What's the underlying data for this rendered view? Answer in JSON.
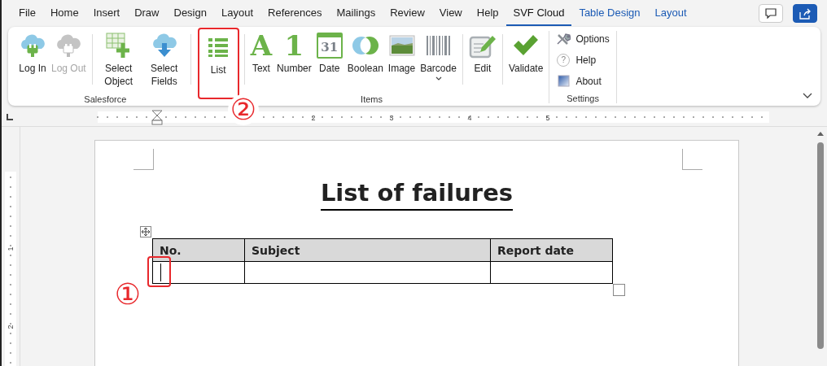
{
  "menu_tabs": [
    {
      "label": "File",
      "selected": false,
      "kind": "standard"
    },
    {
      "label": "Home",
      "selected": false,
      "kind": "standard"
    },
    {
      "label": "Insert",
      "selected": false,
      "kind": "standard"
    },
    {
      "label": "Draw",
      "selected": false,
      "kind": "standard"
    },
    {
      "label": "Design",
      "selected": false,
      "kind": "standard"
    },
    {
      "label": "Layout",
      "selected": false,
      "kind": "standard"
    },
    {
      "label": "References",
      "selected": false,
      "kind": "standard"
    },
    {
      "label": "Mailings",
      "selected": false,
      "kind": "standard"
    },
    {
      "label": "Review",
      "selected": false,
      "kind": "standard"
    },
    {
      "label": "View",
      "selected": false,
      "kind": "standard"
    },
    {
      "label": "Help",
      "selected": false,
      "kind": "standard"
    },
    {
      "label": "SVF Cloud",
      "selected": true,
      "kind": "standard"
    },
    {
      "label": "Table Design",
      "selected": false,
      "kind": "contextual"
    },
    {
      "label": "Layout",
      "selected": false,
      "kind": "contextual"
    }
  ],
  "ribbon": {
    "groups": [
      {
        "label": "Salesforce",
        "items": [
          {
            "kind": "large",
            "label": "Log In",
            "disabled": false,
            "highlighted": false
          },
          {
            "kind": "large",
            "label": "Log Out",
            "disabled": true,
            "highlighted": false
          },
          {
            "kind": "separator"
          },
          {
            "kind": "large",
            "label": "Select Object",
            "disabled": false,
            "highlighted": false
          },
          {
            "kind": "large",
            "label": "Select Fields",
            "disabled": false,
            "highlighted": false
          },
          {
            "kind": "separator"
          }
        ]
      },
      {
        "label": "Items",
        "items": [
          {
            "kind": "large",
            "label": "List",
            "disabled": false,
            "highlighted": true,
            "callout": "②"
          },
          {
            "kind": "separator"
          },
          {
            "kind": "large",
            "label": "Text",
            "glyph": "A",
            "disabled": false,
            "highlighted": false
          },
          {
            "kind": "large",
            "label": "Number",
            "glyph": "1",
            "disabled": false,
            "highlighted": false
          },
          {
            "kind": "large",
            "label": "Date",
            "glyph": "31",
            "disabled": false,
            "highlighted": false
          },
          {
            "kind": "large",
            "label": "Boolean",
            "disabled": false,
            "highlighted": false
          },
          {
            "kind": "large",
            "label": "Image",
            "disabled": false,
            "highlighted": false
          },
          {
            "kind": "large",
            "label": "Barcode",
            "disabled": false,
            "highlighted": false,
            "dropdown": true
          },
          {
            "kind": "separator"
          },
          {
            "kind": "large",
            "label": "Edit",
            "disabled": false,
            "highlighted": false
          },
          {
            "kind": "separator"
          },
          {
            "kind": "large",
            "label": "Validate",
            "disabled": false,
            "highlighted": false
          }
        ]
      },
      {
        "label": "Settings",
        "items": [
          {
            "kind": "small",
            "label": "Options"
          },
          {
            "kind": "small",
            "label": "Help",
            "glyph": "?"
          },
          {
            "kind": "small",
            "label": "About"
          }
        ]
      }
    ]
  },
  "ruler": {
    "horizontal_numbers": [
      "2",
      "3",
      "4",
      "5"
    ],
    "vertical_numbers": [
      "1",
      "2"
    ]
  },
  "document": {
    "title": "List of failures",
    "table": {
      "columns": [
        "No.",
        "Subject",
        "Report date"
      ],
      "rows": [
        {
          "cells": [
            {
              "has_cursor": true,
              "highlighted": true,
              "callout": "①"
            },
            {
              "has_cursor": false,
              "highlighted": false
            },
            {
              "has_cursor": false,
              "highlighted": false
            }
          ]
        }
      ]
    }
  }
}
